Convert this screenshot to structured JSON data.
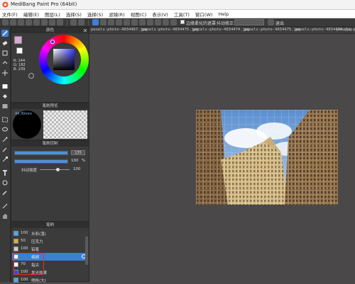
{
  "window": {
    "title": "MediBang Paint Pro (64bit)"
  },
  "menu": [
    "文件(F)",
    "编辑(E)",
    "图层(L)",
    "选择(S)",
    "选择(S)",
    "滤镜(R)",
    "视图(C)",
    "表示(V)",
    "工具(T)",
    "窗口(W)",
    "Help"
  ],
  "toolbar": {
    "checkbox_label": "边缘柔化的遮罩",
    "snap_label": "抖动修正",
    "snap_value": "",
    "exit_label": "退出"
  },
  "file_tabs": [
    "pexels-photo-4034467.jpg",
    "pexels-photo-4034475.jpg",
    "pexels-photo-4034474.jpg",
    "pexels-photo-4034475.jpg",
    "pexels-photo-4034474.jpg",
    "pexels-photo"
  ],
  "color_panel": {
    "title": "颜色",
    "r": "R: 144",
    "g": "G: 182",
    "b": "B: 239",
    "primary_color": "#d9a8d8",
    "secondary_color": "#ffffff"
  },
  "brush_preview": {
    "title": "笔刷预览",
    "size": "44.30mm"
  },
  "brush_control": {
    "title": "笔刷控制",
    "size_value": "135",
    "opacity_value": "100",
    "opacity_unit": "%",
    "correction_label": "抖动强度",
    "correction_value": "100"
  },
  "brush_list": {
    "title": "笔刷",
    "items": [
      {
        "size": "100",
        "name": "水彩(湿)",
        "color": "#44aaee",
        "selected": false
      },
      {
        "size": "50",
        "name": "压克力",
        "color": "#d8b040",
        "selected": false
      },
      {
        "size": "100",
        "name": "铅笔",
        "color": "#cccccc",
        "selected": false
      },
      {
        "size": "",
        "name": "模糊",
        "color": "#ffffff",
        "selected": true
      },
      {
        "size": "70",
        "name": "指尖",
        "color": "#ffffff",
        "selected": false
      },
      {
        "size": "100",
        "name": "发光效果",
        "color": "#3344ee",
        "selected": false
      },
      {
        "size": "100",
        "name": "喷枪(大)",
        "color": "#44aaee",
        "selected": false
      }
    ]
  }
}
